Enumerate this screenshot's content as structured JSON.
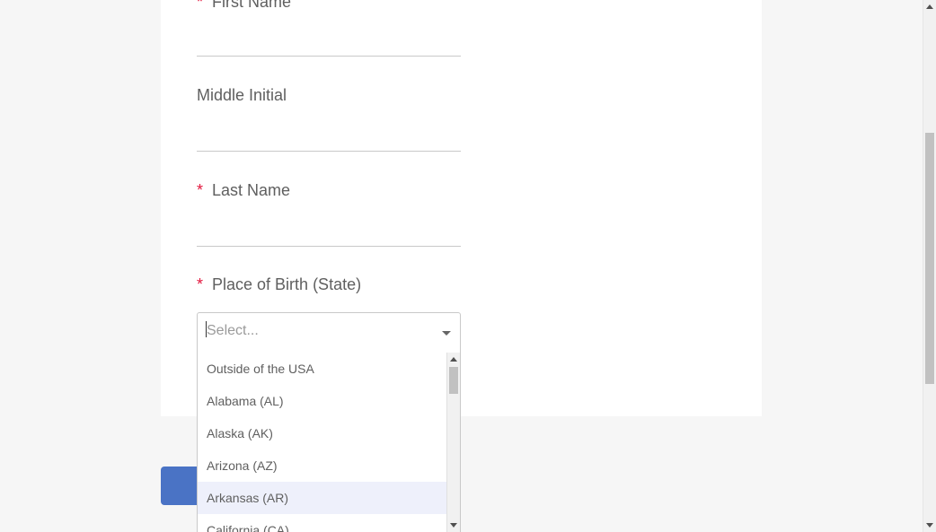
{
  "form": {
    "required_marker": "*",
    "first_name_label": "First Name",
    "middle_initial_label": "Middle Initial",
    "last_name_label": "Last Name",
    "place_of_birth_label": "Place of Birth (State)"
  },
  "place_of_birth_select": {
    "placeholder": "Select...",
    "options": [
      "Outside of the USA",
      "Alabama (AL)",
      "Alaska (AK)",
      "Arizona (AZ)",
      "Arkansas (AR)",
      "California (CA)"
    ],
    "highlighted_option": "Arkansas (AR)"
  },
  "colors": {
    "required": "#e3173e",
    "highlight": "#eef0fb",
    "button": "#4a73c5"
  }
}
